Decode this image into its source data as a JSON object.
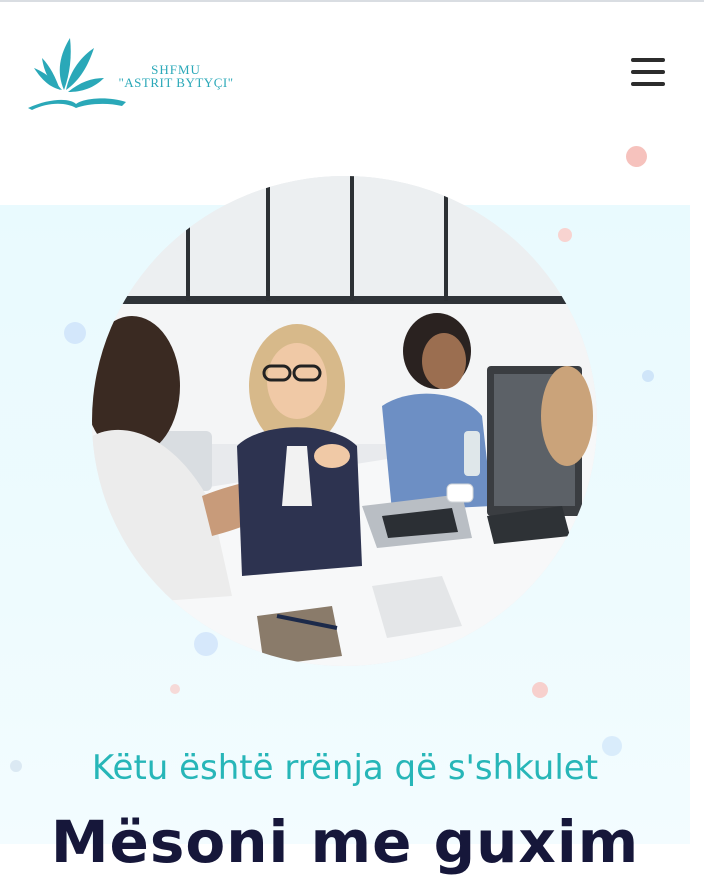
{
  "header": {
    "logo_line1": "SHFMU",
    "logo_line2": "\"ASTRIT BYTYÇI\"",
    "menu_icon": "hamburger-menu-icon"
  },
  "hero": {
    "tagline": "Këtu është rrënja që s'shkulet",
    "title": "Mësoni me guxim"
  },
  "colors": {
    "brand_teal": "#27b6b8",
    "title_navy": "#16173a",
    "hero_bg": "#eaf9fd",
    "accent_pink": "#f4b5b0"
  }
}
